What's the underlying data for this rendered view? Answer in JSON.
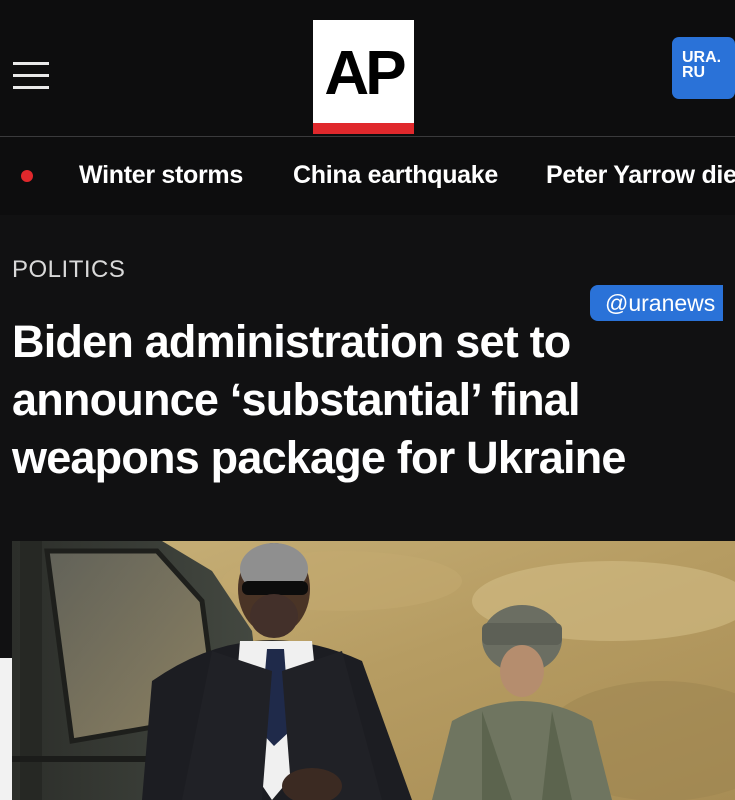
{
  "header": {
    "logo_text": "AP",
    "watermark_badge": "URA.\nRU"
  },
  "trending": {
    "items": [
      "Winter storms",
      "China earthquake",
      "Peter Yarrow die"
    ]
  },
  "article": {
    "category": "POLITICS",
    "headline": "Biden administration set to announce ‘substantial’ final weapons package for Ukraine",
    "image": "photo"
  },
  "watermark": {
    "handle": "@uranews"
  },
  "colors": {
    "background": "#0f0f10",
    "ap_red": "#e0282c",
    "ura_blue": "#2a72d8"
  },
  "icons": [
    "menu-icon",
    "live-dot-icon"
  ]
}
